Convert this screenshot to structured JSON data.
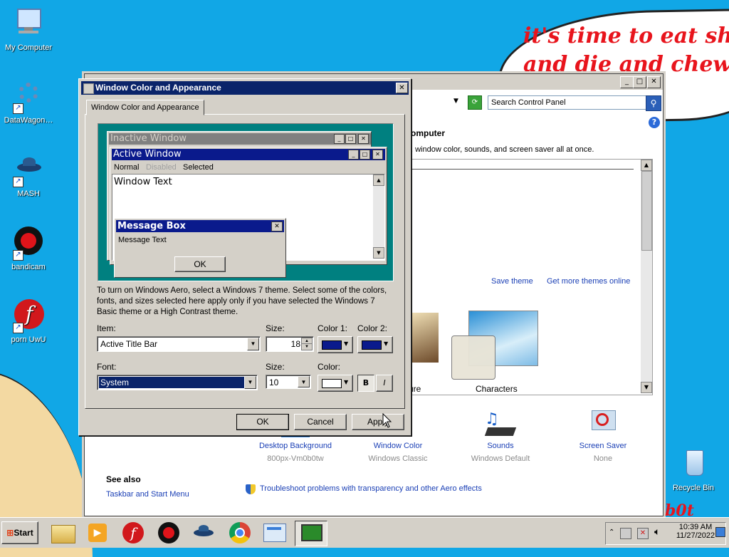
{
  "wallpaper": {
    "cloud_line1": "it's time to eat shit",
    "cloud_line2": "and die and chew",
    "bottom_text": "b0t"
  },
  "desktop_icons": [
    {
      "label": "My Computer",
      "icon": "computer-icon"
    },
    {
      "label": "DataWagon…",
      "icon": "gear-icon"
    },
    {
      "label": "MASH",
      "icon": "spaceship-icon"
    },
    {
      "label": "bandicam",
      "icon": "record-icon"
    },
    {
      "label": "porn UwU",
      "icon": "flash-icon"
    },
    {
      "label": "Recycle Bin",
      "icon": "recycle-bin-icon"
    }
  ],
  "control_panel": {
    "search_placeholder": "Search Control Panel",
    "heading": "omputer",
    "description": ", window color, sounds, and screen saver all at once.",
    "save_theme": "Save theme",
    "get_more_themes": "Get more themes online",
    "themes": [
      {
        "label": "ure"
      },
      {
        "label": "Characters"
      }
    ],
    "bottom_items": [
      {
        "label": "Desktop Background",
        "sub": "800px-Vm0b0tw",
        "icon": "desktop-background-icon"
      },
      {
        "label": "Window Color",
        "sub": "Windows Classic",
        "icon": "window-color-icon"
      },
      {
        "label": "Sounds",
        "sub": "Windows Default",
        "icon": "sounds-icon"
      },
      {
        "label": "Screen Saver",
        "sub": "None",
        "icon": "screen-saver-icon"
      }
    ],
    "see_also": "See also",
    "taskbar_link": "Taskbar and Start Menu",
    "troubleshoot": "Troubleshoot problems with transparency and other Aero effects"
  },
  "dialog": {
    "title": "Window Color and Appearance",
    "tab": "Window Color and Appearance",
    "preview": {
      "inactive_title": "Inactive Window",
      "active_title": "Active Window",
      "menu_normal": "Normal",
      "menu_disabled": "Disabled",
      "menu_selected": "Selected",
      "window_text": "Window Text",
      "msgbox_title": "Message Box",
      "msgbox_text": "Message Text",
      "msgbox_ok": "OK"
    },
    "info_text": "To turn on Windows Aero, select a Windows 7 theme.  Select some of the colors, fonts, and sizes selected here apply only if you have selected the Windows 7 Basic theme or a High Contrast theme.",
    "item_label": "Item:",
    "item_value": "Active Title Bar",
    "size_label": "Size:",
    "item_size": "18",
    "color1_label": "Color 1:",
    "color2_label": "Color 2:",
    "font_label": "Font:",
    "font_value": "System",
    "font_size_label": "Size:",
    "font_size": "10",
    "font_color_label": "Color:",
    "bold_label": "B",
    "italic_label": "I",
    "ok": "OK",
    "cancel": "Cancel",
    "apply": "Apply",
    "colors": {
      "color1": "#0a1a8c",
      "color2": "#0a1a8c",
      "font_color": "#ffffff",
      "preview_bg": "#008080"
    }
  },
  "taskbar": {
    "start": "Start",
    "clock_time": "10:39 AM",
    "clock_date": "11/27/2022",
    "pinned": [
      "explorer-icon",
      "media-player-icon",
      "flash-icon",
      "bandicam-icon",
      "spaceship-icon",
      "chrome-icon",
      "control-panel-icon",
      "display-settings-icon"
    ]
  }
}
